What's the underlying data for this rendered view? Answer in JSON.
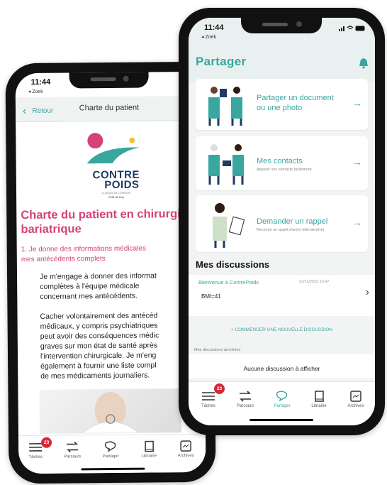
{
  "back_phone": {
    "status": {
      "time": "11:44",
      "back_app": "◂ Zoek"
    },
    "nav": {
      "back_label": "Retour",
      "title": "Charte du patient"
    },
    "logo": {
      "line1": "CONTRE",
      "line2": "POIDS",
      "tagline": "CLINIQUE DE L'OBÉSITÉ",
      "sub": "CHR de Huy"
    },
    "heading": "Charte du patient en chirurgie bariatrique",
    "section": {
      "line1": "1. Je donne des informations médicales",
      "line2": "mes antécédents complets"
    },
    "paragraph1": [
      "Je m'engage à donner des informat",
      "complètes à l'équipe médicale",
      "concernant mes antécédents."
    ],
    "paragraph2": [
      "Cacher volontairement des antécéd",
      "médicaux, y compris psychiatriques",
      "peut avoir des conséquences médic",
      "graves sur mon état de santé après",
      "l'intervention chirurgicale. Je m'eng",
      "également à fournir une liste compl",
      "de mes médicaments journaliers."
    ],
    "tabbar": {
      "badge": "23",
      "tabs": [
        {
          "label": "Tâches",
          "icon": "list-icon"
        },
        {
          "label": "Parcours",
          "icon": "route-icon"
        },
        {
          "label": "Partager",
          "icon": "share-chat-icon"
        },
        {
          "label": "Librairie",
          "icon": "book-icon"
        },
        {
          "label": "Archives",
          "icon": "archive-icon"
        }
      ]
    }
  },
  "front_phone": {
    "status": {
      "time": "11:44",
      "back_app": "◂ Zoek"
    },
    "title": "Partager",
    "bell_icon": "bell-icon",
    "cards": [
      {
        "title_line1": "Partager un document",
        "title_line2": "ou une photo",
        "subtitle": ""
      },
      {
        "title_line1": "Mes contacts",
        "title_line2": "",
        "subtitle": "Appeler vos contacts facilement"
      },
      {
        "title_line1": "Demander un rappel",
        "title_line2": "",
        "subtitle": "Recevoir un appel d'un(e) infirmier(ère)"
      }
    ],
    "discussions": {
      "heading": "Mes discussions",
      "items": [
        {
          "name": "Bienvenue à ContrePoids",
          "date": "22/11/2022 15:47",
          "message": "BMI=41"
        }
      ],
      "new_button": "+ COMMENCER UNE NOUVELLE DISCUSSION",
      "archived_heading": "Mes discussions archivées",
      "archived_empty": "Aucune discussion à afficher"
    },
    "tabbar": {
      "badge": "23",
      "tabs": [
        {
          "label": "Tâches",
          "icon": "list-icon"
        },
        {
          "label": "Parcours",
          "icon": "route-icon"
        },
        {
          "label": "Partager",
          "icon": "share-chat-icon"
        },
        {
          "label": "Librairie",
          "icon": "book-icon"
        },
        {
          "label": "Archives",
          "icon": "archive-icon"
        }
      ]
    }
  },
  "colors": {
    "accent": "#3aa6a0",
    "pink": "#d4427a",
    "badge": "#d6283a",
    "navy": "#1f3a63"
  }
}
